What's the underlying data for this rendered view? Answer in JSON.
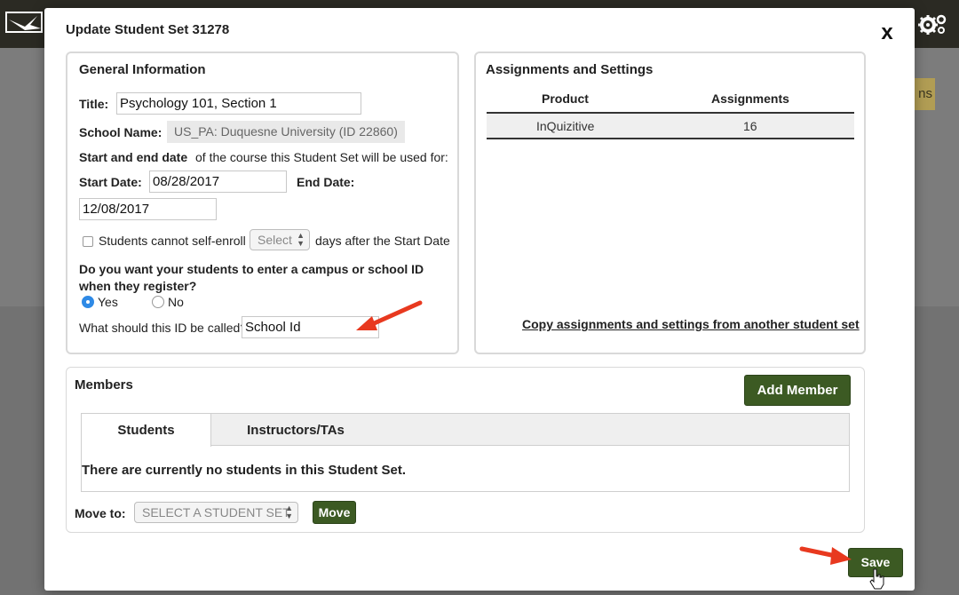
{
  "background": {
    "yellow_button_fragment": "ns"
  },
  "modal": {
    "title": "Update Student Set 31278",
    "close_label": "x"
  },
  "general": {
    "heading": "General Information",
    "title_label": "Title:",
    "title_value": "Psychology 101, Section 1",
    "school_label": "School Name:",
    "school_value": "US_PA: Duquesne University (ID 22860)",
    "dates_bold": "Start and end date",
    "dates_text": "of the course this Student Set will be used for:",
    "start_label": "Start Date:",
    "start_value": "08/28/2017",
    "end_label": "End Date:",
    "end_value": "12/08/2017",
    "self_enroll_label": "Students cannot self-enroll",
    "self_enroll_checked": false,
    "days_select_value": "Select",
    "days_suffix": "days after the Start Date",
    "campus_id_question": "Do you want your students to enter a campus or school ID when they register?",
    "yes_label": "Yes",
    "no_label": "No",
    "selected_option": "Yes",
    "id_name_label": "What should this ID be called?",
    "id_name_value": "School Id"
  },
  "assignments": {
    "heading": "Assignments and Settings",
    "columns": [
      "Product",
      "Assignments"
    ],
    "rows": [
      {
        "product": "InQuizitive",
        "count": "16"
      }
    ],
    "copy_link": "Copy assignments and settings from another student set"
  },
  "members": {
    "heading": "Members",
    "add_button": "Add Member",
    "tabs": [
      "Students",
      "Instructors/TAs"
    ],
    "active_tab": "Students",
    "empty_message": "There are currently no students in this Student Set.",
    "move_label": "Move to:",
    "move_select_value": "SELECT A STUDENT SET",
    "move_button": "Move"
  },
  "footer": {
    "save_button": "Save"
  },
  "colors": {
    "green_button": "#3c5a23",
    "annotation_arrow": "#e8391f",
    "radio_selected": "#2f8ae6",
    "top_bar": "#2b2a23"
  }
}
